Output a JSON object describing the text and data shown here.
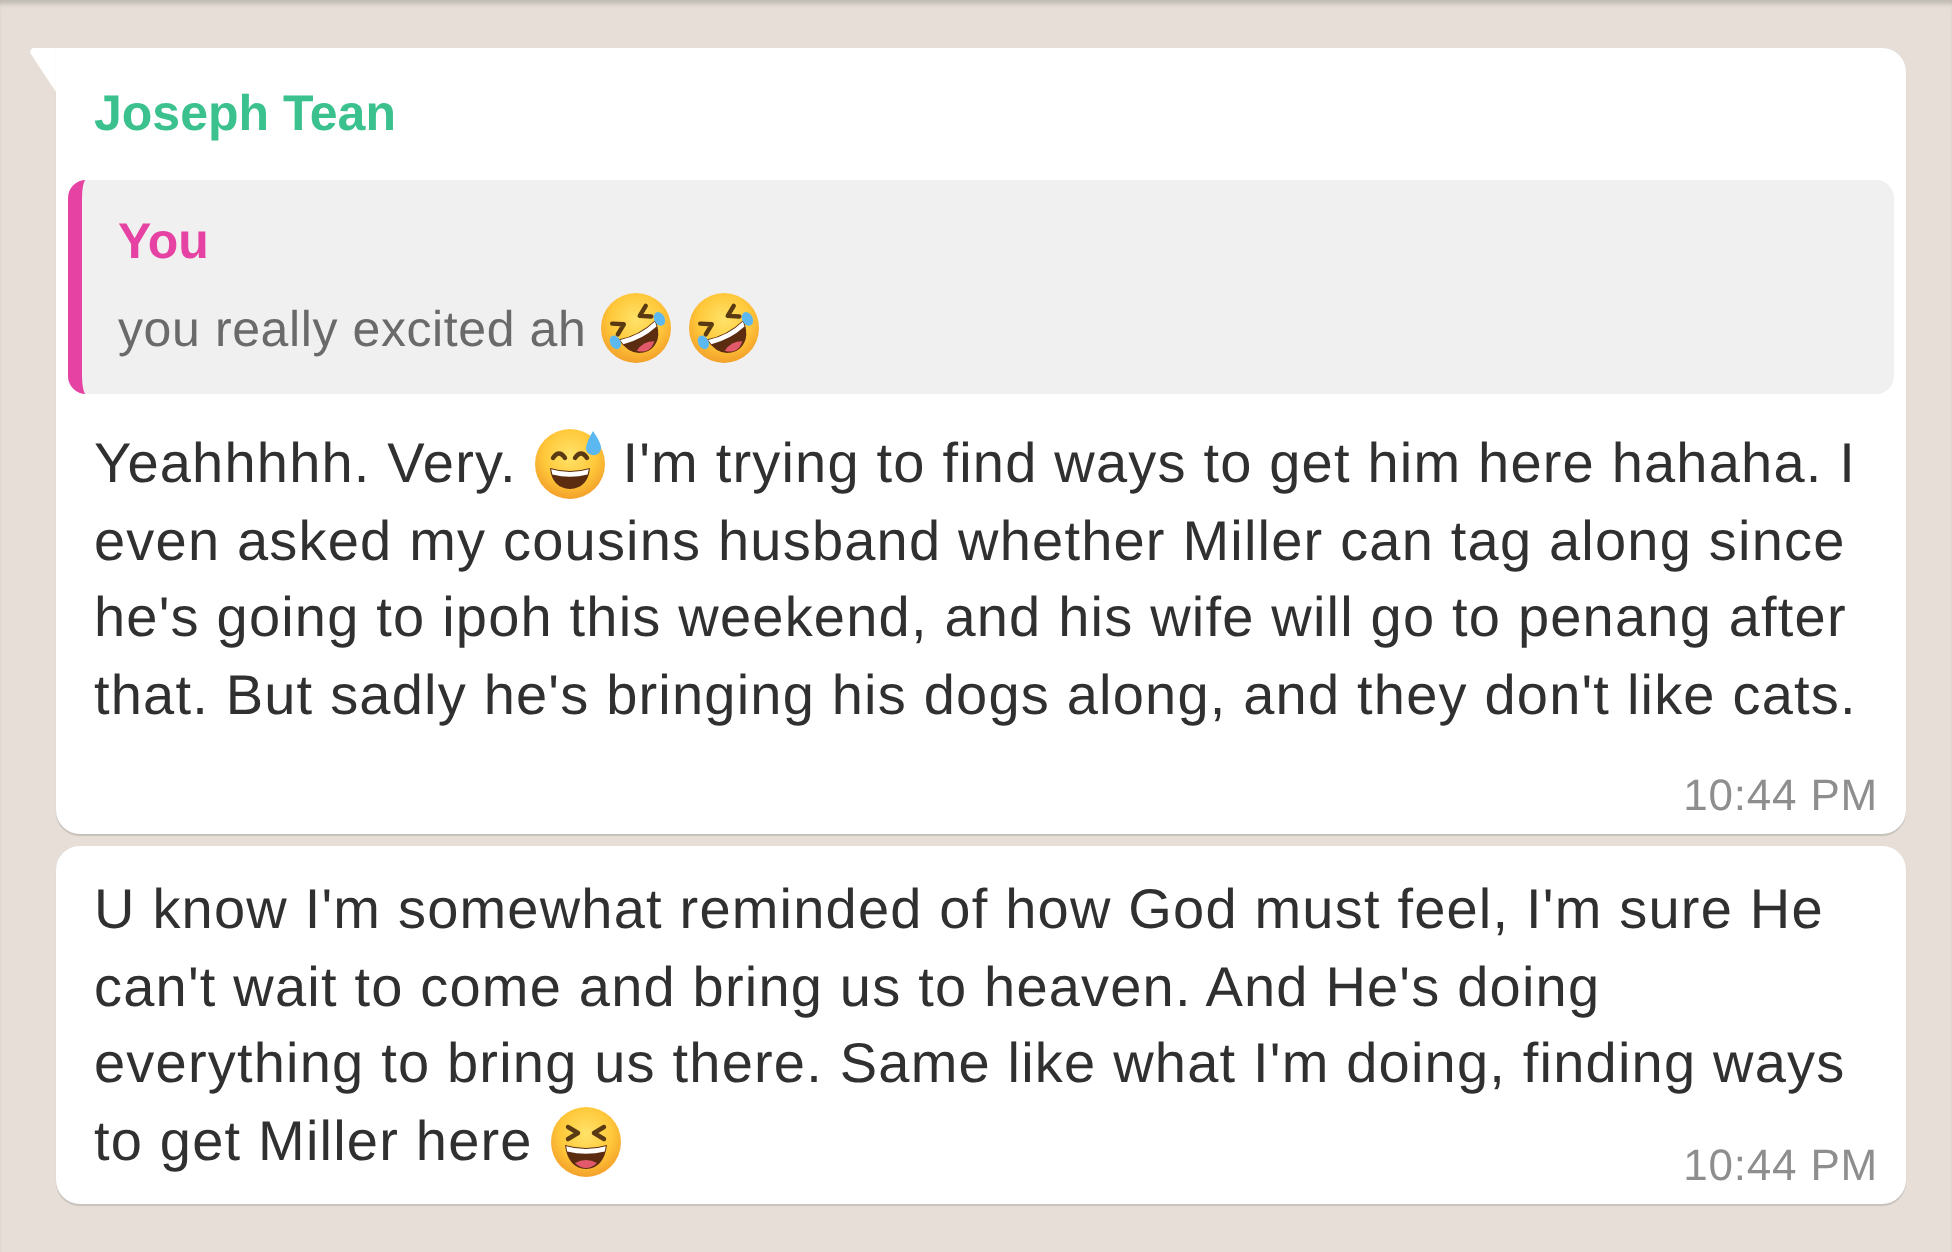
{
  "messages": [
    {
      "tail": true,
      "sender": "Joseph Tean",
      "quote": {
        "author": "You",
        "parts": [
          {
            "kind": "text",
            "text": "you really excited ah"
          },
          {
            "kind": "rofl"
          },
          {
            "kind": "rofl"
          }
        ]
      },
      "rows": [
        {
          "parts": [
            {
              "kind": "text",
              "text": "Yeahhhhh. Very."
            },
            {
              "kind": "sweatsmile"
            },
            {
              "kind": "text",
              "text": "I'm trying to find ways to get him here hahaha. I"
            }
          ]
        },
        {
          "parts": [
            {
              "kind": "text",
              "text": "even asked my cousins husband whether Miller can tag along since he's going to ipoh this weekend, and his wife will go to penang after that. But sadly he's bringing his dogs along, and they don't like cats."
            }
          ]
        }
      ],
      "time": "10:44 PM"
    },
    {
      "tail": false,
      "rows": [
        {
          "parts": [
            {
              "kind": "text",
              "text": "U know I'm somewhat reminded of how God must feel, I'm sure He can't wait to come and bring us to heaven. And He's doing everything to bring us there. Same like what I'm doing, finding ways"
            }
          ]
        },
        {
          "parts": [
            {
              "kind": "text",
              "text": "to get Miller here"
            },
            {
              "kind": "laughing"
            }
          ]
        }
      ],
      "time": "10:44 PM"
    }
  ]
}
